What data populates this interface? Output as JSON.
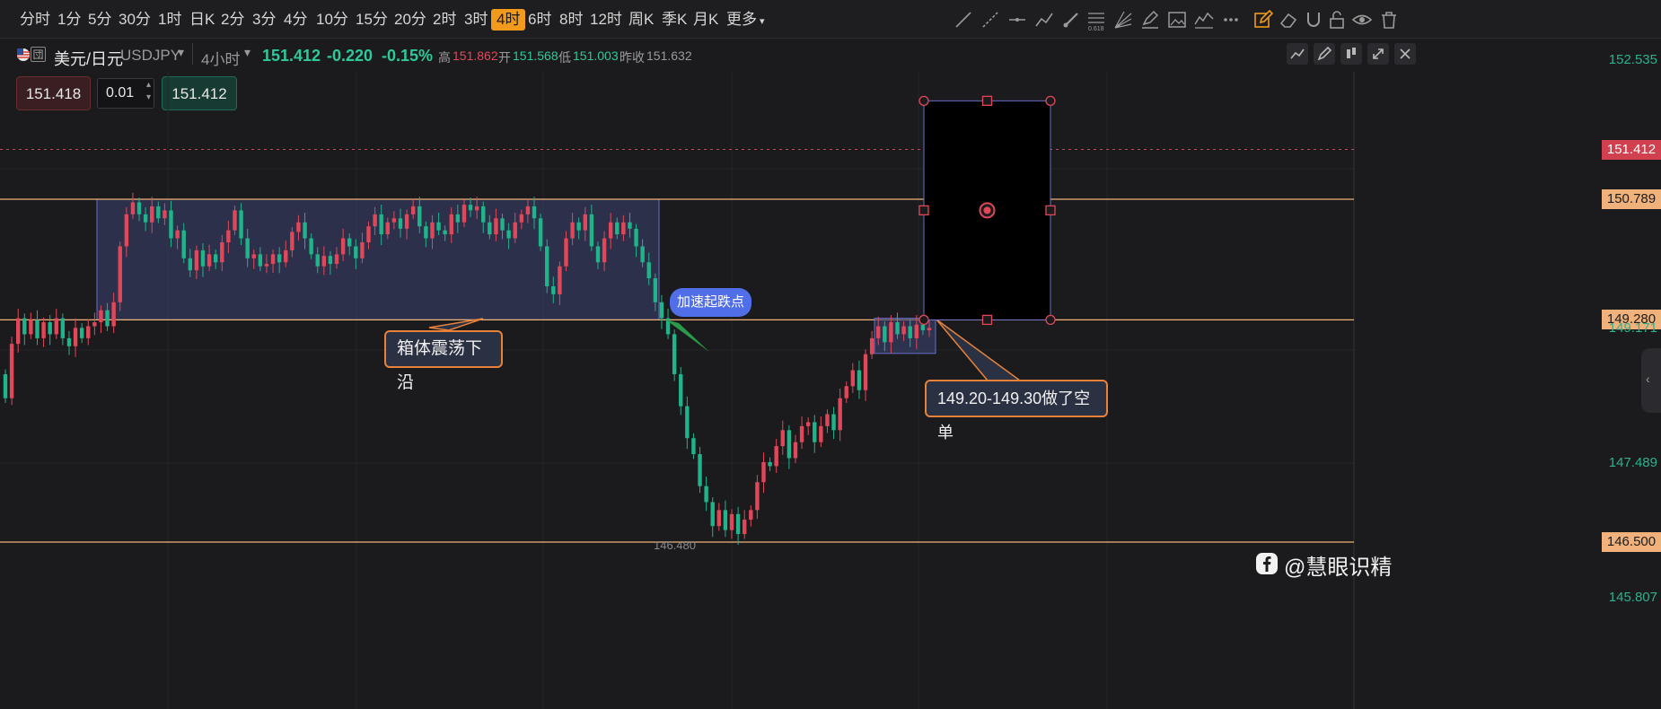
{
  "toolbar": {
    "timeframes": [
      "分时",
      "1分",
      "5分",
      "30分",
      "1时",
      "日K",
      "2分",
      "3分",
      "4分",
      "10分",
      "15分",
      "20分",
      "2时",
      "3时",
      "4时",
      "6时",
      "8时",
      "12时",
      "周K",
      "季K",
      "月K",
      "更多"
    ],
    "active_timeframe": "4时",
    "tool_icons": [
      "trend-line-icon",
      "ray-line-icon",
      "horizontal-line-icon",
      "polyline-icon",
      "brush-icon",
      "fibonacci-icon",
      "gann-fan-icon",
      "highlighter-icon",
      "image-icon",
      "indicator-icon",
      "more-dots-icon",
      "edit-icon",
      "eraser-icon",
      "magnet-icon",
      "lock-icon",
      "eye-icon",
      "delete-icon"
    ],
    "fib_label": "0.618"
  },
  "symbol": {
    "name": "美元/日元",
    "code": "USDJPY",
    "interval": "4小时",
    "last": "151.412",
    "change": "-0.220",
    "change_pct": "-0.15%",
    "high_label": "高",
    "high": "151.862",
    "open_label": "开",
    "open": "151.568",
    "low_label": "低",
    "low": "151.003",
    "prev_close_label": "昨收",
    "prev_close": "151.632"
  },
  "trade_panel": {
    "sell_price": "151.418",
    "lot": "0.01",
    "buy_price": "151.412"
  },
  "price_axis": {
    "labels": [
      {
        "text": "152.535",
        "price": 152.535,
        "style": "tick"
      },
      {
        "text": "151.412",
        "price": 151.412,
        "style": "current"
      },
      {
        "text": "150.789",
        "price": 150.789,
        "style": "level"
      },
      {
        "text": "149.280",
        "price": 149.28,
        "style": "level"
      },
      {
        "text": "149.171",
        "price": 149.171,
        "style": "tick"
      },
      {
        "text": "147.489",
        "price": 147.489,
        "style": "tick"
      },
      {
        "text": "146.500",
        "price": 146.5,
        "style": "level"
      },
      {
        "text": "145.807",
        "price": 145.807,
        "style": "tick"
      }
    ]
  },
  "annotations": {
    "box_lower_label": "箱体震荡下沿",
    "accel_label": "加速起跌点",
    "short_label": "149.20-149.30做了空单",
    "low_marker": "146.480"
  },
  "watermark": {
    "text": "@慧眼识精"
  },
  "colors": {
    "background": "#1b1b1d",
    "up": "#e0485a",
    "down": "#21b38a",
    "level_line": "#f0b27a",
    "range_box": "#3a4270",
    "accent": "#f19a1c"
  },
  "chart_data": {
    "type": "candlestick",
    "symbol": "USDJPY",
    "interval": "4小时",
    "ylim": [
      145.807,
      152.535
    ],
    "current_price": 151.412,
    "horizontal_levels": [
      150.789,
      149.28,
      146.5
    ],
    "range_box": {
      "top": 150.789,
      "bottom": 149.28
    },
    "entry_zone": {
      "top": 149.3,
      "bottom": 148.86
    },
    "candles": [
      [
        148.6,
        148.3
      ],
      [
        148.3,
        148.98
      ],
      [
        148.98,
        149.3
      ],
      [
        149.3,
        149.1
      ],
      [
        149.1,
        149.28
      ],
      [
        149.28,
        149.05
      ],
      [
        149.05,
        149.25
      ],
      [
        149.25,
        149.1
      ],
      [
        149.1,
        149.3
      ],
      [
        149.3,
        149.05
      ],
      [
        149.05,
        148.95
      ],
      [
        148.95,
        149.18
      ],
      [
        149.18,
        149.05
      ],
      [
        149.05,
        149.2
      ],
      [
        149.2,
        149.25
      ],
      [
        149.25,
        149.4
      ],
      [
        149.4,
        149.2
      ],
      [
        149.2,
        149.5
      ],
      [
        149.5,
        150.2
      ],
      [
        150.2,
        150.6
      ],
      [
        150.6,
        150.75
      ],
      [
        150.75,
        150.6
      ],
      [
        150.6,
        150.5
      ],
      [
        150.5,
        150.7
      ],
      [
        150.7,
        150.55
      ],
      [
        150.55,
        150.65
      ],
      [
        150.65,
        150.3
      ],
      [
        150.3,
        150.4
      ],
      [
        150.4,
        150.05
      ],
      [
        150.05,
        149.9
      ],
      [
        149.9,
        150.15
      ],
      [
        150.15,
        149.95
      ],
      [
        149.95,
        150.1
      ],
      [
        150.1,
        150.0
      ],
      [
        150.0,
        150.25
      ],
      [
        150.25,
        150.4
      ],
      [
        150.4,
        150.65
      ],
      [
        150.65,
        150.3
      ],
      [
        150.3,
        150.05
      ],
      [
        150.05,
        150.1
      ],
      [
        150.1,
        149.95
      ],
      [
        149.95,
        149.98
      ],
      [
        149.98,
        150.1
      ],
      [
        150.1,
        150.0
      ],
      [
        150.0,
        150.15
      ],
      [
        150.15,
        150.38
      ],
      [
        150.38,
        150.5
      ],
      [
        150.5,
        150.3
      ],
      [
        150.3,
        150.1
      ],
      [
        150.1,
        149.95
      ],
      [
        149.95,
        150.08
      ],
      [
        150.08,
        149.98
      ],
      [
        149.98,
        150.1
      ],
      [
        150.1,
        150.3
      ],
      [
        150.3,
        150.2
      ],
      [
        150.2,
        150.05
      ],
      [
        150.05,
        150.25
      ],
      [
        150.25,
        150.45
      ],
      [
        150.45,
        150.6
      ],
      [
        150.6,
        150.35
      ],
      [
        150.35,
        150.5
      ],
      [
        150.5,
        150.55
      ],
      [
        150.55,
        150.42
      ],
      [
        150.42,
        150.6
      ],
      [
        150.6,
        150.7
      ],
      [
        150.7,
        150.45
      ],
      [
        150.45,
        150.3
      ],
      [
        150.3,
        150.5
      ],
      [
        150.5,
        150.4
      ],
      [
        150.4,
        150.35
      ],
      [
        150.35,
        150.6
      ],
      [
        150.6,
        150.5
      ],
      [
        150.5,
        150.72
      ],
      [
        150.72,
        150.65
      ],
      [
        150.65,
        150.7
      ],
      [
        150.7,
        150.5
      ],
      [
        150.5,
        150.35
      ],
      [
        150.35,
        150.55
      ],
      [
        150.55,
        150.4
      ],
      [
        150.4,
        150.3
      ],
      [
        150.3,
        150.5
      ],
      [
        150.5,
        150.6
      ],
      [
        150.6,
        150.7
      ],
      [
        150.7,
        150.55
      ],
      [
        150.55,
        150.2
      ],
      [
        150.2,
        149.7
      ],
      [
        149.7,
        149.6
      ],
      [
        149.6,
        149.95
      ],
      [
        149.95,
        150.3
      ],
      [
        150.3,
        150.5
      ],
      [
        150.5,
        150.4
      ],
      [
        150.4,
        150.6
      ],
      [
        150.6,
        150.2
      ],
      [
        150.2,
        150.0
      ],
      [
        150.0,
        150.3
      ],
      [
        150.3,
        150.5
      ],
      [
        150.5,
        150.35
      ],
      [
        150.35,
        150.5
      ],
      [
        150.5,
        150.42
      ],
      [
        150.42,
        150.2
      ],
      [
        150.2,
        150.0
      ],
      [
        150.0,
        149.8
      ],
      [
        149.8,
        149.5
      ],
      [
        149.5,
        149.3
      ],
      [
        149.3,
        149.1
      ],
      [
        149.1,
        148.6
      ],
      [
        148.6,
        148.2
      ],
      [
        148.2,
        147.8
      ],
      [
        147.8,
        147.6
      ],
      [
        147.6,
        147.2
      ],
      [
        147.2,
        147.0
      ],
      [
        147.0,
        146.7
      ],
      [
        146.7,
        146.9
      ],
      [
        146.9,
        146.65
      ],
      [
        146.65,
        146.85
      ],
      [
        146.85,
        146.6
      ],
      [
        146.6,
        146.78
      ],
      [
        146.78,
        146.9
      ],
      [
        146.9,
        147.25
      ],
      [
        147.25,
        147.5
      ],
      [
        147.5,
        147.45
      ],
      [
        147.45,
        147.7
      ],
      [
        147.7,
        147.9
      ],
      [
        147.9,
        147.55
      ],
      [
        147.55,
        147.75
      ],
      [
        147.75,
        147.95
      ],
      [
        147.95,
        148.0
      ],
      [
        148.0,
        147.75
      ],
      [
        147.75,
        147.95
      ],
      [
        147.95,
        148.1
      ],
      [
        148.1,
        147.9
      ],
      [
        147.9,
        148.3
      ],
      [
        148.3,
        148.45
      ],
      [
        148.45,
        148.65
      ],
      [
        148.65,
        148.4
      ],
      [
        148.4,
        148.85
      ],
      [
        148.85,
        149.05
      ],
      [
        149.05,
        149.2
      ],
      [
        149.2,
        149.0
      ],
      [
        149.0,
        149.25
      ],
      [
        149.25,
        149.1
      ],
      [
        149.1,
        149.2
      ],
      [
        149.2,
        149.05
      ],
      [
        149.05,
        149.22
      ],
      [
        149.22,
        149.15
      ],
      [
        149.15,
        149.18
      ]
    ]
  }
}
